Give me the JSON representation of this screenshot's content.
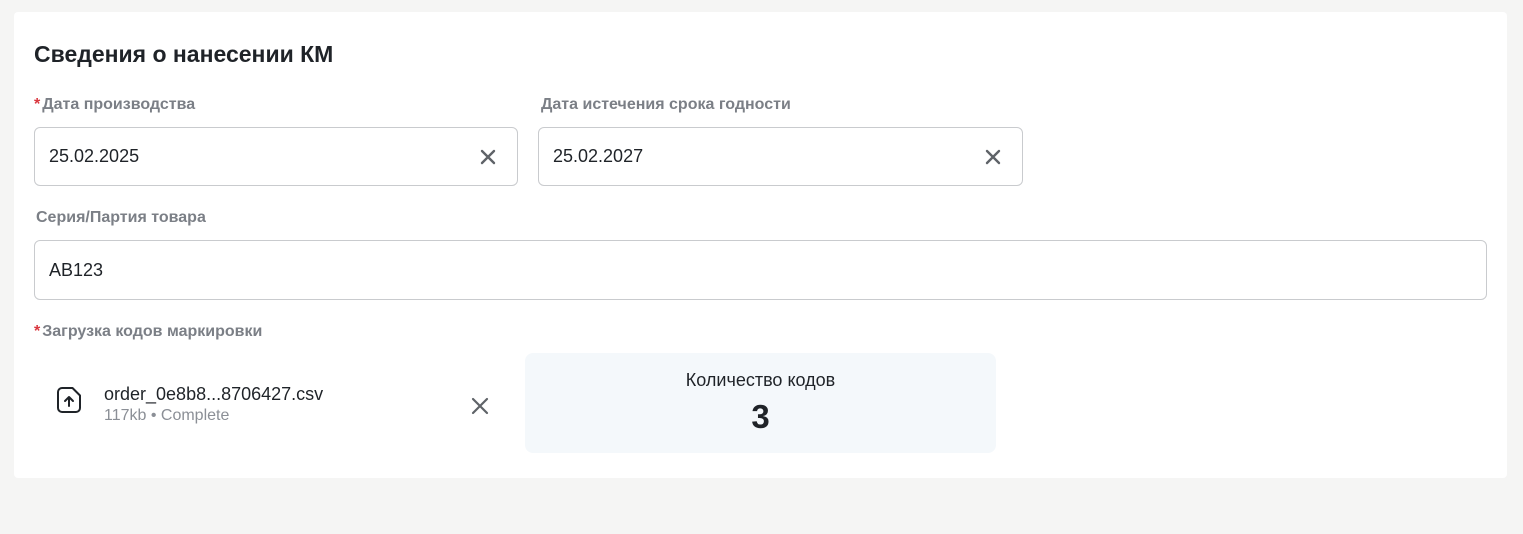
{
  "section": {
    "title": "Сведения о нанесении КМ"
  },
  "fields": {
    "production_date": {
      "required_mark": "*",
      "label": "Дата производства",
      "value": "25.02.2025"
    },
    "expiry_date": {
      "label": "Дата истечения срока годности",
      "value": "25.02.2027"
    },
    "batch": {
      "label": "Серия/Партия товара",
      "value": "AB123"
    },
    "codes_upload": {
      "required_mark": "*",
      "label": "Загрузка кодов маркировки"
    }
  },
  "file": {
    "name": "order_0e8b8...8706427.csv",
    "meta": "117kb • Complete",
    "icon": "file-upload-icon"
  },
  "codes_count": {
    "label": "Количество кодов",
    "value": "3"
  },
  "colors": {
    "background": "#f5f5f4",
    "card": "#ffffff",
    "required": "#d9363e",
    "label": "#7b7f86",
    "count_box": "#f4f8fb"
  }
}
